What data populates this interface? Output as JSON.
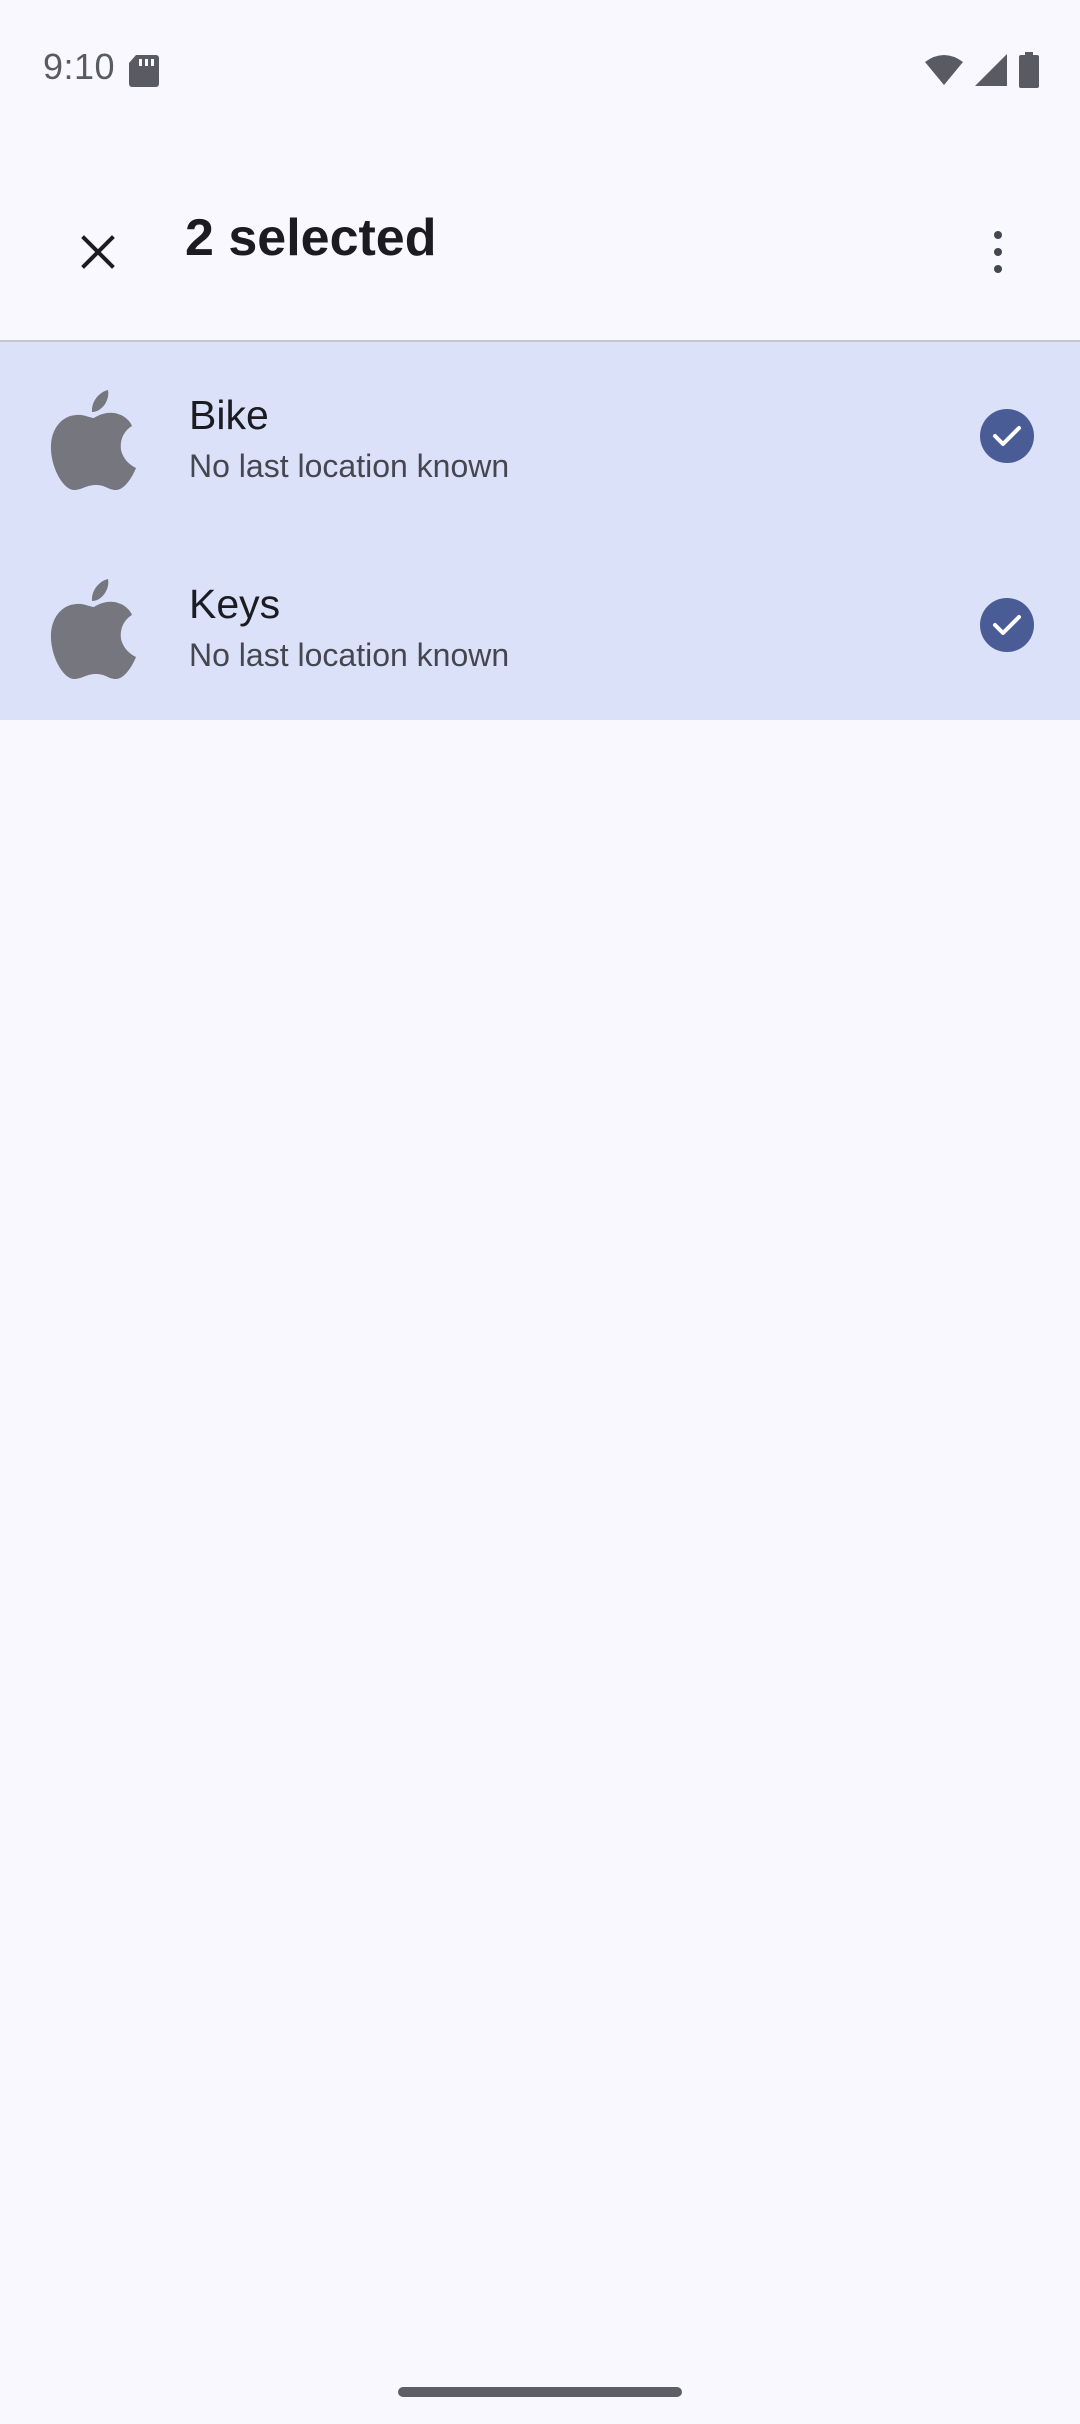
{
  "status_bar": {
    "time": "9:10",
    "icons": [
      "sd-card-icon",
      "wifi-icon",
      "signal-icon",
      "battery-icon"
    ]
  },
  "app_bar": {
    "title": "2 selected",
    "close_icon": "close-icon",
    "more_icon": "more-vert-icon"
  },
  "items": [
    {
      "title": "Bike",
      "subtitle": "No last location known",
      "icon": "apple-icon",
      "selected": true
    },
    {
      "title": "Keys",
      "subtitle": "No last location known",
      "icon": "apple-icon",
      "selected": true
    }
  ],
  "colors": {
    "background": "#f8f8fe",
    "selected_row": "#dce1fa",
    "check_badge": "#4a5c95",
    "icon_gray": "#75767e"
  }
}
